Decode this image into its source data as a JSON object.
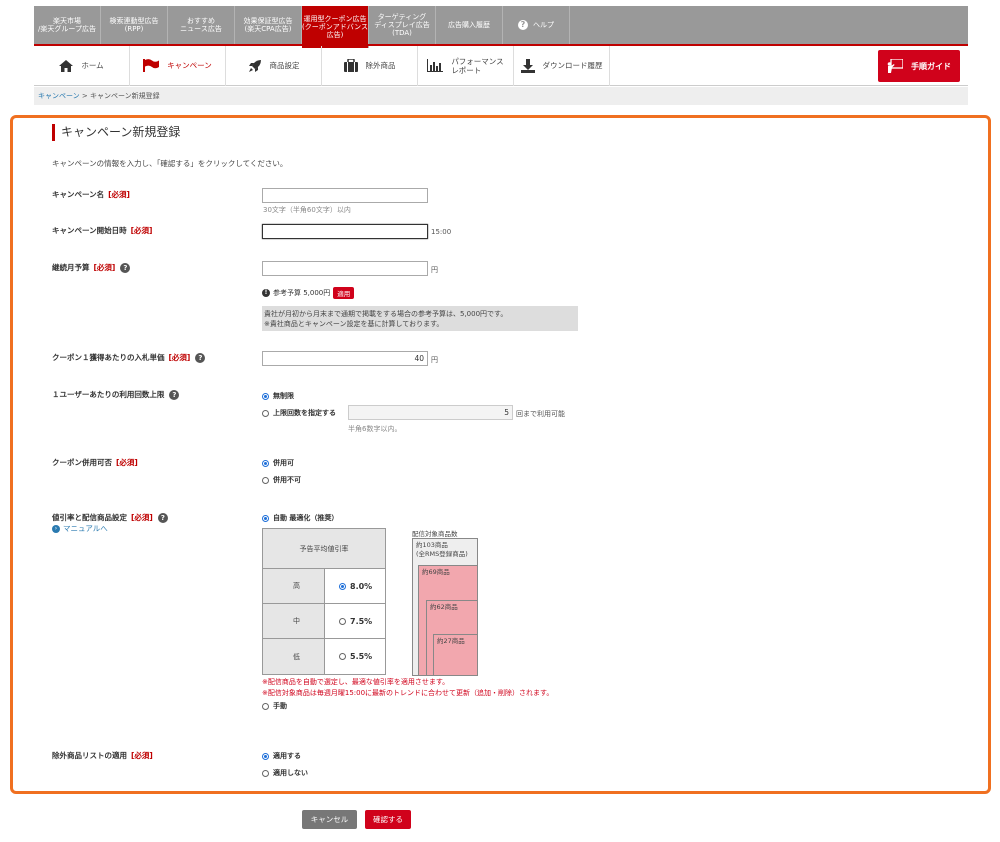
{
  "topnav": [
    {
      "label": "楽天市場\n/楽天グループ広告",
      "active": false
    },
    {
      "label": "検索連動型広告\n(RPP)",
      "active": false
    },
    {
      "label": "おすすめ\nニュース広告",
      "active": false
    },
    {
      "label": "効果保証型広告\n(楽天CPA広告)",
      "active": false
    },
    {
      "label": "運用型クーポン広告\n(クーポンアドバンス\n広告)",
      "active": true
    },
    {
      "label": "ターゲティング\nディスプレイ広告\n(TDA)",
      "active": false
    },
    {
      "label": "広告購入履歴",
      "active": false
    },
    {
      "label": "ヘルプ",
      "active": false
    }
  ],
  "subnav": [
    {
      "label": "ホーム",
      "icon": "home-icon"
    },
    {
      "label": "キャンペーン",
      "icon": "flag-icon"
    },
    {
      "label": "商品設定",
      "icon": "rocket-icon"
    },
    {
      "label": "除外商品",
      "icon": "bag-icon"
    },
    {
      "label": "パフォーマンス\nレポート",
      "icon": "chart-icon"
    },
    {
      "label": "ダウンロード履歴",
      "icon": "download-icon"
    }
  ],
  "guide_button": "手順ガイド",
  "breadcrumb": {
    "link": "キャンペーン",
    "sep": " > ",
    "current": "キャンペーン新規登録"
  },
  "page_title": "キャンペーン新規登録",
  "intro": "キャンペーンの情報を入力し、「確認する」をクリックしてください。",
  "required_tag": "[必須]",
  "fields": {
    "name": {
      "label": "キャンペーン名",
      "value": "",
      "hint": "30文字（半角60文字）以内"
    },
    "start": {
      "label": "キャンペーン開始日時",
      "value": "",
      "time": "15:00"
    },
    "budget": {
      "label": "継続月予算",
      "value": "",
      "unit": "円",
      "ref_label": "参考予算 5,000円",
      "apply": "適用",
      "note1": "貴社が月初から月末まで通期で掲載をする場合の参考予算は、5,000円です。",
      "note2": "※貴社商品とキャンペーン設定を基に計算しております。"
    },
    "bid": {
      "label": "クーポン１獲得あたりの入札単価",
      "value": "40",
      "unit": "円"
    },
    "limit": {
      "label": "１ユーザーあたりの利用回数上限",
      "opt1": "無制限",
      "opt2": "上限回数を指定する",
      "value": "5",
      "suffix": "回まで利用可能",
      "hint": "半角6数字以内。"
    },
    "combine": {
      "label": "クーポン併用可否",
      "opt1": "併用可",
      "opt2": "併用不可"
    },
    "discount": {
      "label": "値引率と配信商品設定",
      "manual_link": "マニュアルへ",
      "opt_auto": "自動 最適化（推奨）",
      "table_header": "予告平均値引率",
      "rows": [
        {
          "level": "高",
          "rate": "8.0%"
        },
        {
          "level": "中",
          "rate": "7.5%"
        },
        {
          "level": "低",
          "rate": "5.5%"
        }
      ],
      "stack_title": "配信対象商品数",
      "stack": [
        "約103商品\n(全RMS登録商品)",
        "約69商品",
        "約62商品",
        "約27商品"
      ],
      "note1": "※配信商品を自動で選定し、最適な値引率を適用させます。",
      "note2": "※配信対象商品は毎週月曜15:00に最新のトレンドに合わせて更新（追加・削除）されます。",
      "opt_manual": "手動"
    },
    "exclude": {
      "label": "除外商品リストの適用",
      "opt1": "適用する",
      "opt2": "適用しない"
    }
  },
  "buttons": {
    "cancel": "キャンセル",
    "confirm": "確認する"
  },
  "colors": {
    "brand_red": "#bf0000",
    "frame_orange": "#f07020",
    "radio_blue": "#1e6fd9",
    "stack_pink": "#f2a7ae"
  }
}
